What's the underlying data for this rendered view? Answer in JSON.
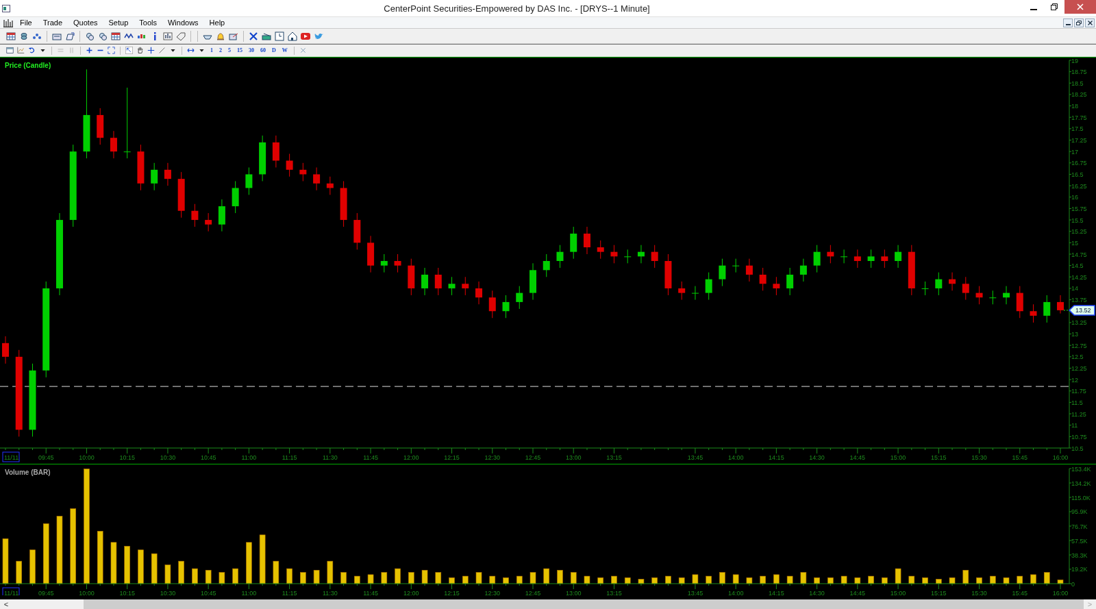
{
  "window": {
    "title": "CenterPoint Securities-Empowered by DAS Inc. - [DRYS--1 Minute]"
  },
  "menu": [
    "File",
    "Trade",
    "Quotes",
    "Setup",
    "Tools",
    "Windows",
    "Help"
  ],
  "interval_buttons": [
    "1",
    "2",
    "5",
    "15",
    "30",
    "60",
    "D",
    "W"
  ],
  "price_chart": {
    "title": "Price (Candle)",
    "date_label": "11/11",
    "last_price": "13.52",
    "chart_data": {
      "type": "candlestick",
      "ylim": [
        10.5,
        19
      ],
      "ref_lines": [
        {
          "axis": "y",
          "value": 11.85
        }
      ],
      "categories": [
        null,
        null,
        null,
        "09:45",
        null,
        null,
        "10:00",
        null,
        null,
        "10:15",
        null,
        null,
        "10:30",
        null,
        null,
        "10:45",
        null,
        null,
        "11:00",
        null,
        null,
        "11:15",
        null,
        null,
        "11:30",
        null,
        null,
        "11:45",
        null,
        null,
        "12:00",
        null,
        null,
        "12:15",
        null,
        null,
        "12:30",
        null,
        null,
        "12:45",
        null,
        null,
        "13:00",
        null,
        null,
        "13:15",
        null,
        null,
        null,
        null,
        null,
        "13:45",
        null,
        null,
        "14:00",
        null,
        null,
        "14:15",
        null,
        null,
        "14:30",
        null,
        null,
        "14:45",
        null,
        null,
        "15:00",
        null,
        null,
        "15:15",
        null,
        null,
        "15:30",
        null,
        null,
        "15:45",
        null,
        null,
        "16:00"
      ],
      "ohlc": [
        [
          12.8,
          12.95,
          12.35,
          12.5
        ],
        [
          12.5,
          12.65,
          10.75,
          10.9
        ],
        [
          10.9,
          12.35,
          10.75,
          12.2
        ],
        [
          12.2,
          14.15,
          12.05,
          14.0
        ],
        [
          14.0,
          15.65,
          13.85,
          15.5
        ],
        [
          15.5,
          17.15,
          15.35,
          17.0
        ],
        [
          17.0,
          18.8,
          16.85,
          17.8
        ],
        [
          17.8,
          17.95,
          17.15,
          17.3
        ],
        [
          17.3,
          17.45,
          16.85,
          17.0
        ],
        [
          17.0,
          18.4,
          16.85,
          17.0
        ],
        [
          17.0,
          17.15,
          16.15,
          16.3
        ],
        [
          16.3,
          16.75,
          16.15,
          16.6
        ],
        [
          16.6,
          16.75,
          16.25,
          16.4
        ],
        [
          16.4,
          16.55,
          15.55,
          15.7
        ],
        [
          15.7,
          15.85,
          15.35,
          15.5
        ],
        [
          15.5,
          15.65,
          15.25,
          15.4
        ],
        [
          15.4,
          15.95,
          15.25,
          15.8
        ],
        [
          15.8,
          16.35,
          15.65,
          16.2
        ],
        [
          16.2,
          16.65,
          16.05,
          16.5
        ],
        [
          16.5,
          17.35,
          16.35,
          17.2
        ],
        [
          17.2,
          17.35,
          16.65,
          16.8
        ],
        [
          16.8,
          16.95,
          16.45,
          16.6
        ],
        [
          16.6,
          16.75,
          16.35,
          16.5
        ],
        [
          16.5,
          16.65,
          16.15,
          16.3
        ],
        [
          16.3,
          16.45,
          16.05,
          16.2
        ],
        [
          16.2,
          16.35,
          15.35,
          15.5
        ],
        [
          15.5,
          15.65,
          14.85,
          15.0
        ],
        [
          15.0,
          15.15,
          14.35,
          14.5
        ],
        [
          14.5,
          14.75,
          14.35,
          14.6
        ],
        [
          14.6,
          14.75,
          14.35,
          14.5
        ],
        [
          14.5,
          14.65,
          13.85,
          14.0
        ],
        [
          14.0,
          14.45,
          13.85,
          14.3
        ],
        [
          14.3,
          14.45,
          13.85,
          14.0
        ],
        [
          14.0,
          14.25,
          13.85,
          14.1
        ],
        [
          14.1,
          14.25,
          13.85,
          14.0
        ],
        [
          14.0,
          14.15,
          13.65,
          13.8
        ],
        [
          13.8,
          13.95,
          13.35,
          13.5
        ],
        [
          13.5,
          13.85,
          13.35,
          13.7
        ],
        [
          13.7,
          14.05,
          13.55,
          13.9
        ],
        [
          13.9,
          14.55,
          13.75,
          14.4
        ],
        [
          14.4,
          14.75,
          14.25,
          14.6
        ],
        [
          14.6,
          14.95,
          14.45,
          14.8
        ],
        [
          14.8,
          15.35,
          14.65,
          15.2
        ],
        [
          15.2,
          15.35,
          14.75,
          14.9
        ],
        [
          14.9,
          15.05,
          14.65,
          14.8
        ],
        [
          14.8,
          14.95,
          14.55,
          14.7
        ],
        [
          14.7,
          14.85,
          14.55,
          14.7
        ],
        [
          14.7,
          14.95,
          14.55,
          14.8
        ],
        [
          14.8,
          14.95,
          14.45,
          14.6
        ],
        [
          14.6,
          14.75,
          13.85,
          14.0
        ],
        [
          14.0,
          14.15,
          13.75,
          13.9
        ],
        [
          13.9,
          14.05,
          13.75,
          13.9
        ],
        [
          13.9,
          14.35,
          13.75,
          14.2
        ],
        [
          14.2,
          14.65,
          14.05,
          14.5
        ],
        [
          14.5,
          14.65,
          14.35,
          14.5
        ],
        [
          14.5,
          14.65,
          14.15,
          14.3
        ],
        [
          14.3,
          14.45,
          13.95,
          14.1
        ],
        [
          14.1,
          14.25,
          13.85,
          14.0
        ],
        [
          14.0,
          14.45,
          13.85,
          14.3
        ],
        [
          14.3,
          14.65,
          14.15,
          14.5
        ],
        [
          14.5,
          14.95,
          14.35,
          14.8
        ],
        [
          14.8,
          14.95,
          14.55,
          14.7
        ],
        [
          14.7,
          14.85,
          14.55,
          14.7
        ],
        [
          14.7,
          14.85,
          14.45,
          14.6
        ],
        [
          14.6,
          14.85,
          14.45,
          14.7
        ],
        [
          14.7,
          14.85,
          14.45,
          14.6
        ],
        [
          14.6,
          14.95,
          14.45,
          14.8
        ],
        [
          14.8,
          14.95,
          13.85,
          14.0
        ],
        [
          14.0,
          14.15,
          13.85,
          14.0
        ],
        [
          14.0,
          14.35,
          13.85,
          14.2
        ],
        [
          14.2,
          14.35,
          13.95,
          14.1
        ],
        [
          14.1,
          14.25,
          13.75,
          13.9
        ],
        [
          13.9,
          14.05,
          13.65,
          13.8
        ],
        [
          13.8,
          13.95,
          13.65,
          13.8
        ],
        [
          13.8,
          14.05,
          13.65,
          13.9
        ],
        [
          13.9,
          14.05,
          13.35,
          13.5
        ],
        [
          13.5,
          13.65,
          13.25,
          13.4
        ],
        [
          13.4,
          13.85,
          13.25,
          13.7
        ],
        [
          13.7,
          13.85,
          13.45,
          13.52
        ]
      ],
      "yticks": [
        10.5,
        10.75,
        11,
        11.25,
        11.5,
        11.75,
        12,
        12.25,
        12.5,
        12.75,
        13,
        13.25,
        13.75,
        14,
        14.25,
        14.5,
        14.75,
        15,
        15.25,
        15.5,
        15.75,
        16,
        16.25,
        16.5,
        16.75,
        17,
        17.25,
        17.5,
        17.75,
        18,
        18.25,
        18.5,
        18.75,
        19
      ]
    }
  },
  "volume_chart": {
    "title": "Volume (BAR)",
    "date_label": "11/11",
    "chart_data": {
      "type": "bar",
      "ylim": [
        0,
        153.4
      ],
      "categories": [
        null,
        null,
        null,
        "09:45",
        null,
        null,
        "10:00",
        null,
        null,
        "10:15",
        null,
        null,
        "10:30",
        null,
        null,
        "10:45",
        null,
        null,
        "11:00",
        null,
        null,
        "11:15",
        null,
        null,
        "11:30",
        null,
        null,
        "11:45",
        null,
        null,
        "12:00",
        null,
        null,
        "12:15",
        null,
        null,
        "12:30",
        null,
        null,
        "12:45",
        null,
        null,
        "13:00",
        null,
        null,
        "13:15",
        null,
        null,
        null,
        null,
        null,
        "13:45",
        null,
        null,
        "14:00",
        null,
        null,
        "14:15",
        null,
        null,
        "14:30",
        null,
        null,
        "14:45",
        null,
        null,
        "15:00",
        null,
        null,
        "15:15",
        null,
        null,
        "15:30",
        null,
        null,
        "15:45",
        null,
        null,
        "16:00"
      ],
      "series": [
        {
          "color": "#e6c200",
          "values": [
            60,
            30,
            45,
            80,
            90,
            100,
            153,
            70,
            55,
            50,
            45,
            40,
            25,
            30,
            20,
            18,
            15,
            20,
            55,
            65,
            30,
            20,
            15,
            18,
            30,
            15,
            10,
            12,
            15,
            20,
            15,
            18,
            15,
            8,
            10,
            15,
            10,
            8,
            10,
            15,
            20,
            18,
            15,
            10,
            8,
            10,
            8,
            6,
            8,
            10,
            8,
            12,
            10,
            15,
            12,
            8,
            10,
            12,
            10,
            15,
            8,
            8,
            10,
            8,
            10,
            8,
            20,
            10,
            8,
            6,
            8,
            18,
            8,
            10,
            8,
            10,
            12,
            15,
            5
          ]
        }
      ],
      "yticks": [
        {
          "value": 0,
          "label": "0"
        },
        {
          "value": 19.2,
          "label": "19.2K"
        },
        {
          "value": 38.3,
          "label": "38.3K"
        },
        {
          "value": 57.5,
          "label": "57.5K"
        },
        {
          "value": 76.7,
          "label": "76.7K"
        },
        {
          "value": 95.9,
          "label": "95.9K"
        },
        {
          "value": 115.0,
          "label": "115.0K"
        },
        {
          "value": 134.2,
          "label": "134.2K"
        },
        {
          "value": 153.4,
          "label": "153.4K"
        }
      ]
    }
  },
  "scrollbar": {
    "left": "<",
    "right": ">"
  }
}
